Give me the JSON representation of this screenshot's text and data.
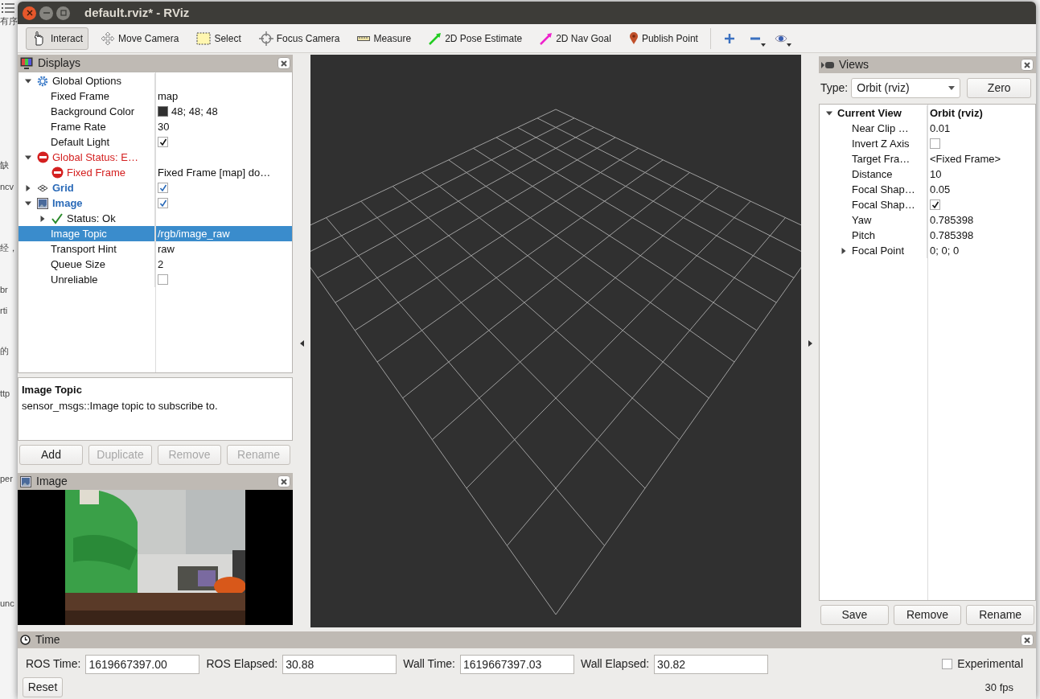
{
  "background_fragments": [
    "有序",
    "缺",
    "ncv",
    "经，",
    "br",
    "rti",
    "的",
    "ttp",
    "per",
    "unc"
  ],
  "window": {
    "title": "default.rviz* - RViz"
  },
  "toolbar": {
    "tools": [
      {
        "label": "Interact",
        "kind": "interact",
        "selected": true
      },
      {
        "label": "Move Camera",
        "kind": "move_camera",
        "selected": false
      },
      {
        "label": "Select",
        "kind": "select",
        "selected": false
      },
      {
        "label": "Focus Camera",
        "kind": "focus_camera",
        "selected": false
      },
      {
        "label": "Measure",
        "kind": "measure",
        "selected": false
      },
      {
        "label": "2D Pose Estimate",
        "kind": "pose",
        "color": "#22cc22",
        "selected": false
      },
      {
        "label": "2D Nav Goal",
        "kind": "pose",
        "color": "#ee22cc",
        "selected": false
      },
      {
        "label": "Publish Point",
        "kind": "point",
        "selected": false
      }
    ],
    "icon_buttons": [
      {
        "kind": "plus",
        "dropdown": false
      },
      {
        "kind": "minus",
        "dropdown": true
      },
      {
        "kind": "eye",
        "dropdown": true
      }
    ]
  },
  "displays": {
    "title": "Displays",
    "tree": [
      {
        "label": "Global Options",
        "kind": "group",
        "expanded": true,
        "selected": false,
        "children": [
          {
            "label": "Fixed Frame",
            "kind": "property",
            "value": "map",
            "selected": false
          },
          {
            "label": "Background Color",
            "kind": "property",
            "value": "48; 48; 48",
            "color": "#303030",
            "selected": false
          },
          {
            "label": "Frame Rate",
            "kind": "property",
            "value": "30",
            "selected": false
          },
          {
            "label": "Default Light",
            "kind": "property",
            "checked": true,
            "selected": false
          }
        ]
      },
      {
        "label": "Global Status: E…",
        "kind": "error",
        "expanded": true,
        "selected": false,
        "children": [
          {
            "label": "Fixed Frame",
            "kind": "error",
            "value": "Fixed Frame [map] do…",
            "selected": false
          }
        ]
      },
      {
        "label": "Grid",
        "kind": "grid_display",
        "expanded": false,
        "checked": true,
        "selected": false
      },
      {
        "label": "Image",
        "kind": "image_display",
        "expanded": true,
        "checked": true,
        "selected": false,
        "children": [
          {
            "label": "Status: Ok",
            "kind": "status",
            "expanded": false,
            "selected": false
          },
          {
            "label": "Image Topic",
            "kind": "property",
            "value": "/rgb/image_raw",
            "selected": true
          },
          {
            "label": "Transport Hint",
            "kind": "property",
            "value": "raw",
            "selected": false
          },
          {
            "label": "Queue Size",
            "kind": "property",
            "value": "2",
            "selected": false
          },
          {
            "label": "Unreliable",
            "kind": "property",
            "checked": false,
            "selected": false
          }
        ]
      }
    ],
    "description": {
      "title": "Image Topic",
      "text": "sensor_msgs::Image topic to subscribe to."
    },
    "buttons": [
      {
        "label": "Add",
        "disabled": false
      },
      {
        "label": "Duplicate",
        "disabled": true
      },
      {
        "label": "Remove",
        "disabled": true
      },
      {
        "label": "Rename",
        "disabled": true
      }
    ]
  },
  "image_panel": {
    "title": "Image",
    "kind": "picture"
  },
  "views": {
    "title": "Views",
    "type_label": "Type:",
    "type_value": "Orbit (rviz)",
    "zero_button": "Zero",
    "tree": [
      {
        "label": "Current View",
        "kind": "header",
        "value": "Orbit (rviz)",
        "expanded": true,
        "children": [
          {
            "label": "Near Clip …",
            "kind": "property",
            "value": "0.01"
          },
          {
            "label": "Invert Z Axis",
            "kind": "property",
            "checked": false
          },
          {
            "label": "Target Fra…",
            "kind": "property",
            "value": "<Fixed Frame>"
          },
          {
            "label": "Distance",
            "kind": "property",
            "value": "10"
          },
          {
            "label": "Focal Shap…",
            "kind": "property",
            "value": "0.05"
          },
          {
            "label": "Focal Shap…",
            "kind": "property",
            "checked": true
          },
          {
            "label": "Yaw",
            "kind": "property",
            "value": "0.785398"
          },
          {
            "label": "Pitch",
            "kind": "property",
            "value": "0.785398"
          },
          {
            "label": "Focal Point",
            "kind": "property",
            "value": "0; 0; 0",
            "expanded": false
          }
        ]
      }
    ],
    "buttons": [
      "Save",
      "Remove",
      "Rename"
    ]
  },
  "time": {
    "title": "Time",
    "fields": [
      {
        "label": "ROS Time:",
        "value": "1619667397.00"
      },
      {
        "label": "ROS Elapsed:",
        "value": "30.88"
      },
      {
        "label": "Wall Time:",
        "value": "1619667397.03"
      },
      {
        "label": "Wall Elapsed:",
        "value": "30.82"
      }
    ],
    "experimental": {
      "label": "Experimental",
      "checked": false
    },
    "reset_button": "Reset",
    "fps": "30 fps"
  }
}
